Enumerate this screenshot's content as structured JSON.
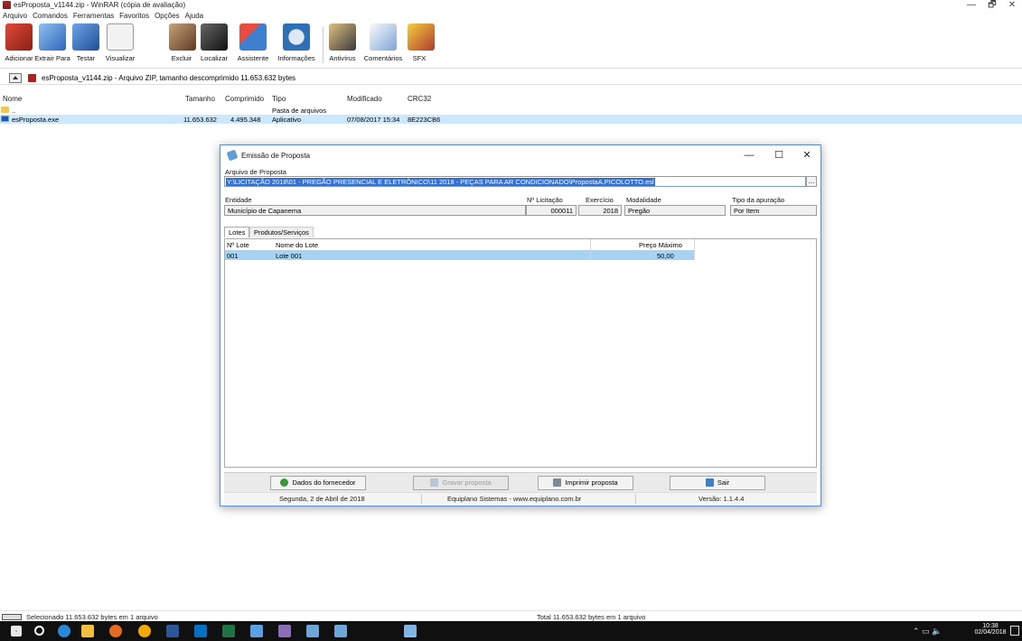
{
  "window": {
    "title": "esProposta_v1144.zip - WinRAR (cópia de avaliação)",
    "minimize": "—",
    "maximize": "🗗",
    "close": "✕"
  },
  "menu": [
    "Arquivo",
    "Comandos",
    "Ferramentas",
    "Favoritos",
    "Opções",
    "Ajuda"
  ],
  "toolbar": [
    {
      "label": "Adicionar",
      "icon": "add-archive-icon",
      "color": "#c0392b"
    },
    {
      "label": "Extrair Para",
      "icon": "extract-to-icon",
      "color": "#3a7bd5"
    },
    {
      "label": "Testar",
      "icon": "test-icon",
      "color": "#2e5fa8"
    },
    {
      "label": "Visualizar",
      "icon": "view-icon",
      "color": "#888888"
    },
    {
      "label": "Excluir",
      "icon": "delete-icon",
      "color": "#7a4a2a"
    },
    {
      "label": "Localizar",
      "icon": "find-icon",
      "color": "#444444"
    },
    {
      "label": "Assistente",
      "icon": "wizard-icon",
      "color": "#4a7fc1"
    },
    {
      "label": "Informações",
      "icon": "info-icon",
      "color": "#2f6fb5"
    },
    {
      "label": "Antivírus",
      "icon": "antivirus-icon",
      "color": "#a87a2a"
    },
    {
      "label": "Comentários",
      "icon": "comments-icon",
      "color": "#3f6fb0"
    },
    {
      "label": "SFX",
      "icon": "sfx-icon",
      "color": "#d4a017"
    }
  ],
  "address": {
    "path": "esProposta_v1144.zip - Arquivo ZIP, tamanho descomprimido 11.653.632 bytes"
  },
  "filelist": {
    "headers": {
      "name": "Nome",
      "size": "Tamanho",
      "packed": "Comprimido",
      "type": "Tipo",
      "modified": "Modificado",
      "crc": "CRC32"
    },
    "rows": [
      {
        "name": "..",
        "size": "",
        "packed": "",
        "type": "Pasta de arquivos",
        "modified": "",
        "crc": ""
      },
      {
        "name": "esProposta.exe",
        "size": "11.653.632",
        "packed": "4.495.348",
        "type": "Aplicativo",
        "modified": "07/08/2017 15:34",
        "crc": "8E223CB6"
      }
    ]
  },
  "status": {
    "left": "Selecionado 11.653.632 bytes em 1 arquivo",
    "right": "Total 11.653.632 bytes em 1 arquivo"
  },
  "tray": {
    "time": "10:38",
    "date": "02/04/2018"
  },
  "dialog": {
    "title": "Emissão de Proposta",
    "minimize": "—",
    "maximize": "☐",
    "close": "✕",
    "arquivo_label": "Arquivo de Proposta",
    "arquivo_value": "Y:\\LICITAÇÃO 2018\\01 - PREGÃO PRESENCIAL E ELETRÔNICO\\11 2018 - PEÇAS PARA AR CONDICIONADO\\PropostaA.PICOLOTTO.esl",
    "arquivo_btn": "...",
    "entidade_label": "Entidade",
    "entidade_value": "Município de Capanema",
    "licitacao_label": "Nº Licitação",
    "licitacao_value": "000011",
    "exercicio_label": "Exercício",
    "exercicio_value": "2018",
    "modalidade_label": "Modalidade",
    "modalidade_value": "Pregão",
    "apuracao_label": "Tipo da apuração",
    "apuracao_value": "Por Item",
    "tabs": [
      "Lotes",
      "Produtos/Serviços"
    ],
    "grid": {
      "headers": {
        "lote": "Nº Lote",
        "nome": "Nome do Lote",
        "preco": "Preço Máximo"
      },
      "rows": [
        {
          "lote": "001",
          "nome": "Lote 001",
          "preco": "50,00"
        }
      ]
    },
    "buttons": {
      "fornecedor": "Dados do fornecedor",
      "gravar": "Gravar proposta",
      "imprimir": "Imprimir proposta",
      "sair": "Sair"
    },
    "statusbar": {
      "date": "Segunda, 2 de Abril de 2018",
      "company": "Equiplano Sistemas - www.equiplano.com.br",
      "version": "Versão: 1.1.4.4"
    }
  }
}
